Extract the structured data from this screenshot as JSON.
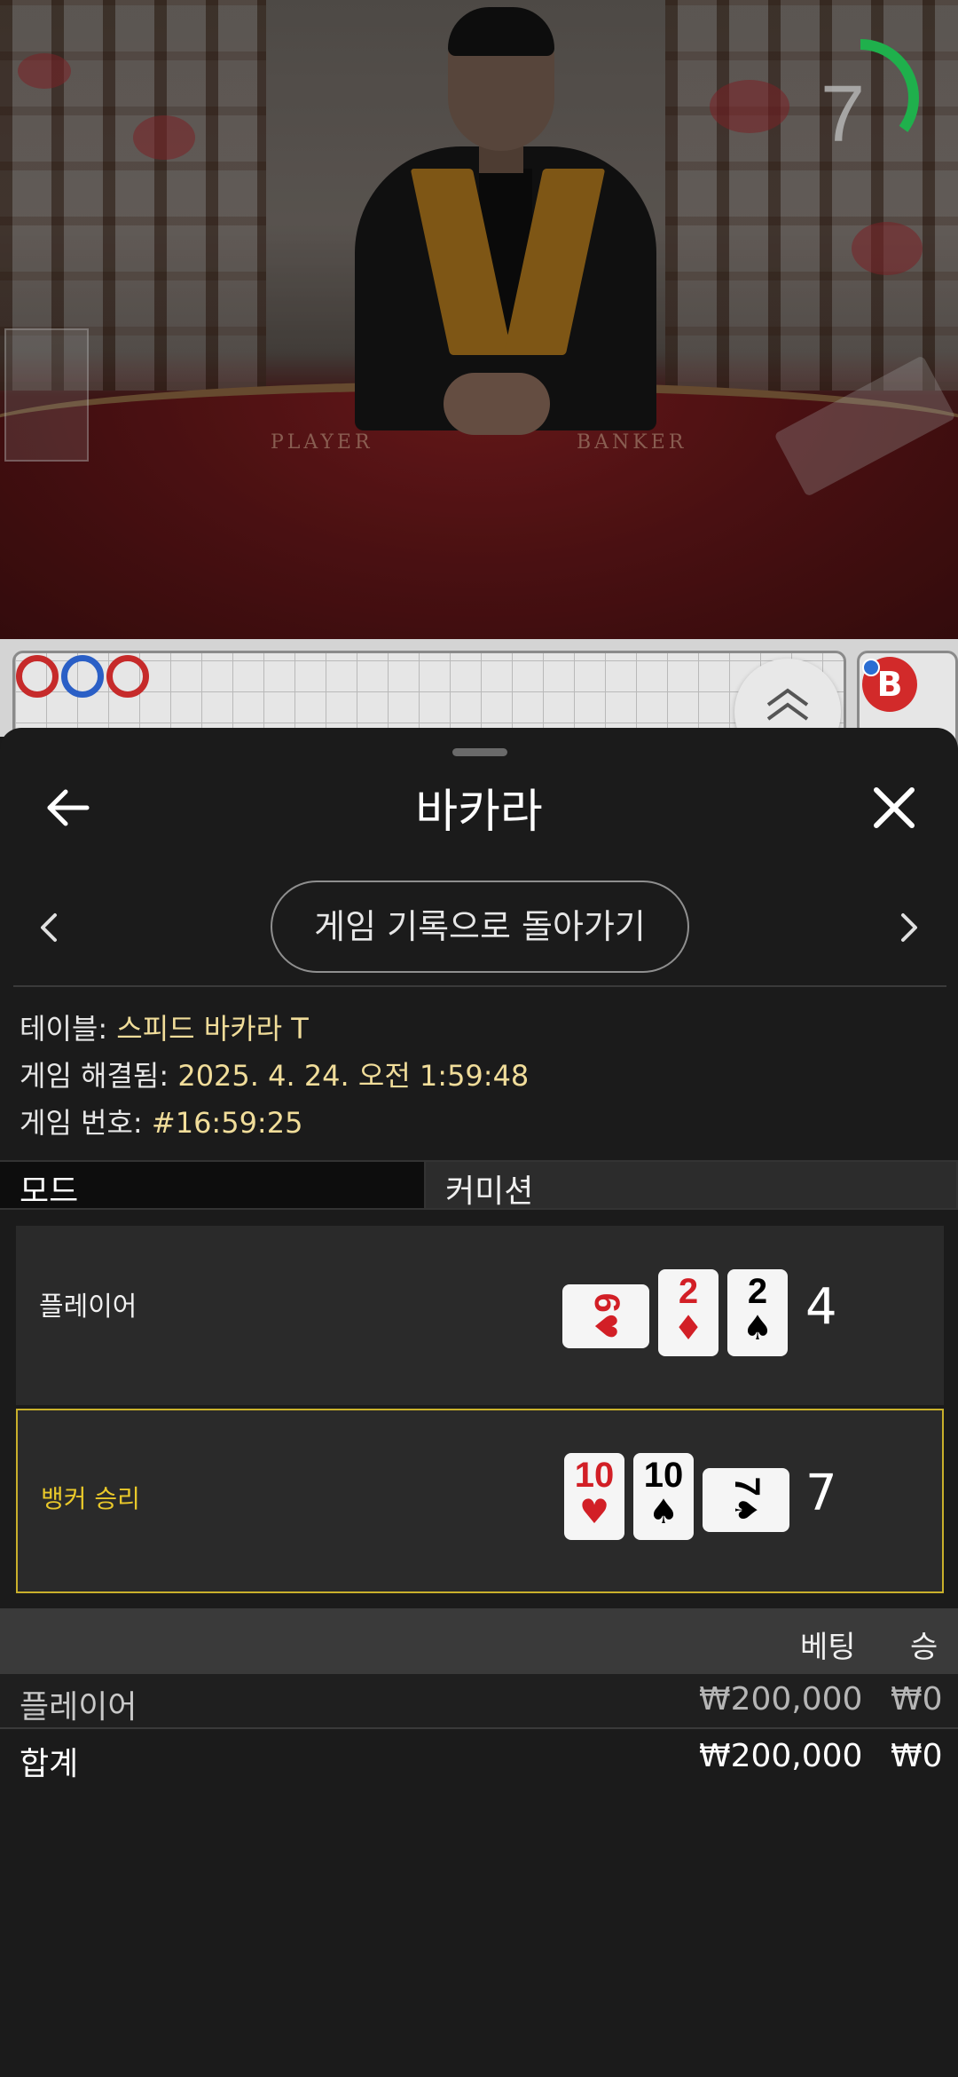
{
  "video": {
    "felt_player_text": "PLAYER",
    "felt_banker_text": "BANKER",
    "timer_value": "7",
    "timer_fraction": 0.35
  },
  "roadmap": {
    "badge_text": "B"
  },
  "sheet": {
    "title": "바카라",
    "history_button": "게임 기록으로 돌아가기",
    "info": {
      "table_label": "테이블: ",
      "table_value": "스피드 바카라 T",
      "resolved_label": "게임 해결됨: ",
      "resolved_value": "2025. 4. 24. 오전 1:59:48",
      "game_no_label": "게임 번호: ",
      "game_no_value": "#16:59:25"
    },
    "mode": {
      "label": "모드",
      "value": "커미션"
    },
    "results": {
      "player": {
        "label": "플레이어",
        "cards": [
          {
            "rank": "6",
            "suit": "♥",
            "side": true
          },
          {
            "rank": "2",
            "suit": "♦",
            "side": false
          },
          {
            "rank": "2",
            "suit": "♠",
            "side": false
          }
        ],
        "total": "4"
      },
      "banker": {
        "label": "뱅커 승리",
        "cards": [
          {
            "rank": "10",
            "suit": "♥",
            "side": false
          },
          {
            "rank": "10",
            "suit": "♠",
            "side": false
          },
          {
            "rank": "7",
            "suit": "♠",
            "side": true
          }
        ],
        "total": "7"
      }
    },
    "bets": {
      "header_bet": "베팅",
      "header_win": "승",
      "rows": [
        {
          "name": "플레이어",
          "bet": "₩200,000",
          "win": "₩0"
        },
        {
          "name": "합계",
          "bet": "₩200,000",
          "win": "₩0"
        }
      ]
    }
  },
  "colors": {
    "accent_gold": "#c9b02b",
    "info_value": "#f1dd9a",
    "banker_red": "#d22a2a",
    "player_blue": "#2a6dd2",
    "timer_green": "#1fb04c"
  }
}
